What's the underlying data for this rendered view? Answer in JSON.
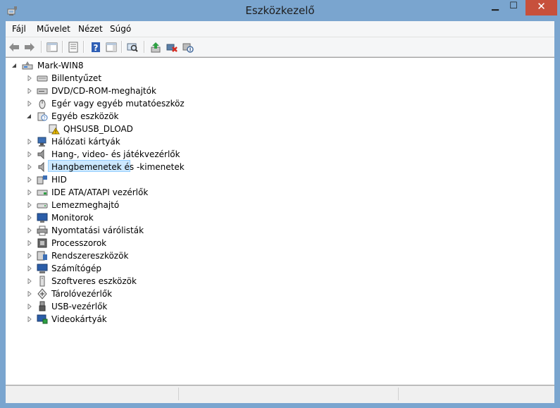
{
  "window": {
    "title": "Eszközkezelő",
    "minimize_glyph": "▁",
    "maximize_glyph": "☐",
    "close_glyph": "✕",
    "accent": "#7aa5cf",
    "close_color": "#c7503c"
  },
  "menu": {
    "file": "Fájl",
    "action": "Művelet",
    "view": "Nézet",
    "help": "Súgó"
  },
  "toolbar": {
    "icons": [
      "back-arrow-icon",
      "forward-arrow-icon",
      "show-hide-console-tree-icon",
      "properties-icon",
      "help-icon",
      "show-action-pane-icon",
      "update-driver-icon",
      "scan-hardware-icon",
      "disable-device-icon",
      "uninstall-device-icon"
    ]
  },
  "tree": {
    "root": "Mark-WIN8",
    "items": [
      {
        "label": "Billentyűzet",
        "icon": "keyboard-icon",
        "expanded": false
      },
      {
        "label": "DVD/CD-ROM-meghajtók",
        "icon": "dvd-drive-icon",
        "expanded": false
      },
      {
        "label": "Egér vagy egyéb mutatóeszköz",
        "icon": "mouse-icon",
        "expanded": false
      },
      {
        "label": "Egyéb eszközök",
        "icon": "other-devices-icon",
        "expanded": true
      },
      {
        "label": "QHSUSB_DLOAD",
        "icon": "warning-device-icon",
        "child": true
      },
      {
        "label": "Hálózati kártyák",
        "icon": "network-adapter-icon",
        "expanded": false
      },
      {
        "label": "Hang-, video- és játékvezérlők",
        "icon": "sound-icon",
        "expanded": false
      },
      {
        "label": "Hangbemenetek és -kimenetek",
        "icon": "audio-io-icon",
        "expanded": false
      },
      {
        "label": "HID",
        "icon": "hid-icon",
        "expanded": false
      },
      {
        "label": "IDE ATA/ATAPI vezérlők",
        "icon": "ide-controller-icon",
        "expanded": false
      },
      {
        "label": "Lemezmeghajtó",
        "icon": "disk-drive-icon",
        "expanded": false
      },
      {
        "label": "Monitorok",
        "icon": "monitor-icon",
        "expanded": false
      },
      {
        "label": "Nyomtatási várólisták",
        "icon": "printer-icon",
        "expanded": false
      },
      {
        "label": "Processzorok",
        "icon": "processor-icon",
        "expanded": false
      },
      {
        "label": "Rendszereszközök",
        "icon": "system-devices-icon",
        "expanded": false
      },
      {
        "label": "Számítógép",
        "icon": "computer-icon",
        "expanded": false
      },
      {
        "label": "Szoftveres eszközök",
        "icon": "software-device-icon",
        "expanded": false
      },
      {
        "label": "Tárolóvezérlők",
        "icon": "storage-controller-icon",
        "expanded": false
      },
      {
        "label": "USB-vezérlők",
        "icon": "usb-controller-icon",
        "expanded": false
      },
      {
        "label": "Videokártyák",
        "icon": "display-adapter-icon",
        "expanded": false
      }
    ]
  }
}
